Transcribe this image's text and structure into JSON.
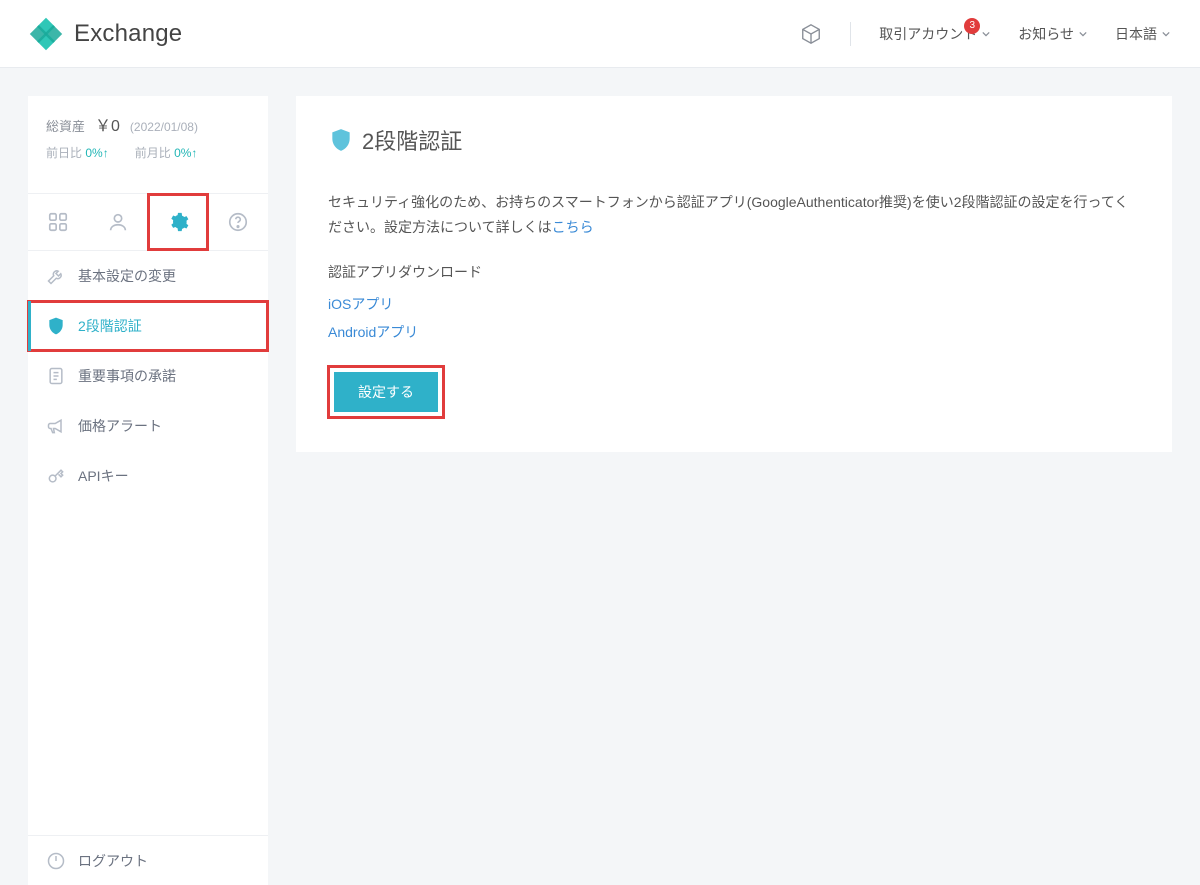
{
  "header": {
    "brand": "Exchange",
    "account_label": "取引アカウント",
    "account_badge": "3",
    "notice_label": "お知らせ",
    "lang_label": "日本語"
  },
  "sidebar": {
    "assets_label": "総資産",
    "assets_amount": "￥0",
    "assets_date": "(2022/01/08)",
    "delta_day_label": "前日比",
    "delta_day_value": "0%↑",
    "delta_month_label": "前月比",
    "delta_month_value": "0%↑",
    "menu": {
      "basic": "基本設定の変更",
      "twofa": "2段階認証",
      "terms": "重要事項の承諾",
      "alert": "価格アラート",
      "api": "APIキー"
    },
    "logout": "ログアウト"
  },
  "main": {
    "title": "2段階認証",
    "desc_a": "セキュリティ強化のため、お持ちのスマートフォンから認証アプリ(GoogleAuthenticator推奨)を使い2段階認証の設定を行ってください。設定方法について詳しくは",
    "desc_link": "こちら",
    "dl_title": "認証アプリダウンロード",
    "dl_ios": "iOSアプリ",
    "dl_android": "Androidアプリ",
    "btn": "設定する"
  }
}
